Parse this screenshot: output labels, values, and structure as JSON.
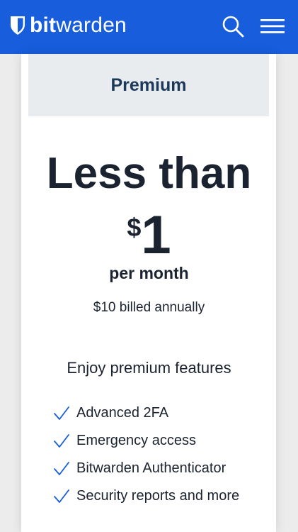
{
  "header": {
    "logo_bold": "bit",
    "logo_light": "warden",
    "search_icon": "search-icon",
    "menu_icon": "hamburger-menu-icon",
    "background_color": "#175ddc"
  },
  "plan": {
    "name": "Premium",
    "headline": "Less than",
    "currency": "$",
    "amount": "1",
    "period": "per month",
    "billing": "$10 billed annually",
    "features_title": "Enjoy premium features",
    "features": [
      {
        "label": "Advanced 2FA",
        "icon": "check-icon"
      },
      {
        "label": "Emergency access",
        "icon": "check-icon"
      },
      {
        "label": "Bitwarden Authenticator",
        "icon": "check-icon"
      },
      {
        "label": "Security reports and more",
        "icon": "check-icon"
      }
    ]
  },
  "colors": {
    "brand_blue": "#175ddc",
    "text_dark": "#1b2330",
    "plan_name": "#1b3a5a",
    "card_header_bg": "#e9ecef"
  }
}
